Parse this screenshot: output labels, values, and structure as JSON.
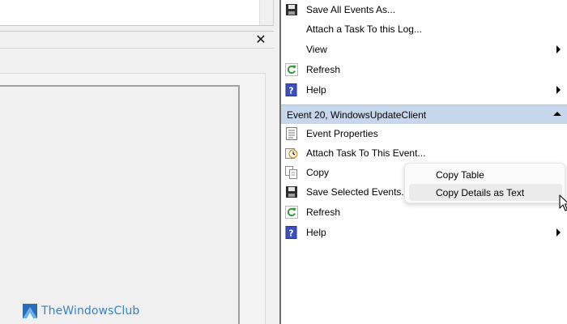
{
  "left_pane": {
    "close_glyph": "✕"
  },
  "actions_top": [
    {
      "label": "Save All Events As...",
      "icon": "save-icon",
      "submenu": false
    },
    {
      "label": "Attach a Task To this Log...",
      "icon": "",
      "submenu": false
    },
    {
      "label": "View",
      "icon": "",
      "submenu": true
    },
    {
      "label": "Refresh",
      "icon": "refresh-icon",
      "submenu": false
    },
    {
      "label": "Help",
      "icon": "help-icon",
      "submenu": true
    }
  ],
  "event_section": {
    "title": "Event 20, WindowsUpdateClient",
    "items": [
      {
        "label": "Event Properties",
        "icon": "event-properties-icon",
        "submenu": false
      },
      {
        "label": "Attach Task To This Event...",
        "icon": "attach-task-icon",
        "submenu": false
      },
      {
        "label": "Copy",
        "icon": "copy-icon",
        "submenu": false
      },
      {
        "label": "Save Selected Events...",
        "icon": "save-icon",
        "submenu": false
      },
      {
        "label": "Refresh",
        "icon": "refresh-icon",
        "submenu": false
      },
      {
        "label": "Help",
        "icon": "help-icon",
        "submenu": true
      }
    ]
  },
  "context_menu": {
    "items": [
      {
        "label": "Copy Table"
      },
      {
        "label": "Copy Details as Text",
        "hovered": true
      }
    ]
  },
  "watermark": {
    "text": "TheWindowsClub"
  },
  "colors": {
    "section_header_bg": "#c7d7eb",
    "watermark_text": "#3a82c4",
    "refresh_green": "#2e9b3a",
    "help_blue": "#3b4fc4"
  }
}
